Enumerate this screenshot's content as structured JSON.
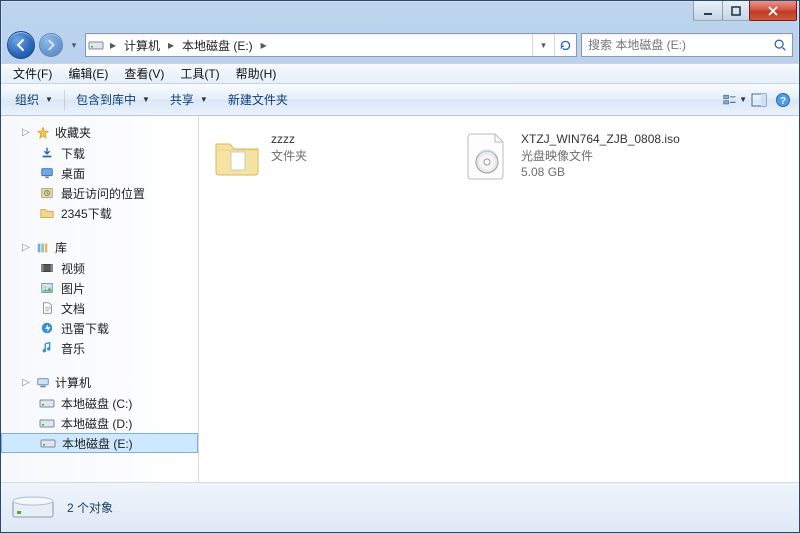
{
  "window": {
    "title": ""
  },
  "nav": {
    "crumbs": [
      "计算机",
      "本地磁盘 (E:)"
    ],
    "search_placeholder": "搜索 本地磁盘 (E:)"
  },
  "menu": {
    "file": "文件(F)",
    "edit": "编辑(E)",
    "view": "查看(V)",
    "tools": "工具(T)",
    "help": "帮助(H)"
  },
  "toolbar": {
    "organize": "组织",
    "include": "包含到库中",
    "share": "共享",
    "newfolder": "新建文件夹"
  },
  "sidebar": {
    "favorites": {
      "label": "收藏夹",
      "items": [
        {
          "label": "下载",
          "icon": "download-icon"
        },
        {
          "label": "桌面",
          "icon": "desktop-icon"
        },
        {
          "label": "最近访问的位置",
          "icon": "recent-icon"
        },
        {
          "label": "2345下载",
          "icon": "folder-icon"
        }
      ]
    },
    "libraries": {
      "label": "库",
      "items": [
        {
          "label": "视频",
          "icon": "video-icon"
        },
        {
          "label": "图片",
          "icon": "pictures-icon"
        },
        {
          "label": "文档",
          "icon": "documents-icon"
        },
        {
          "label": "迅雷下载",
          "icon": "thunder-icon"
        },
        {
          "label": "音乐",
          "icon": "music-icon"
        }
      ]
    },
    "computer": {
      "label": "计算机",
      "items": [
        {
          "label": "本地磁盘 (C:)",
          "icon": "drive-icon",
          "selected": false
        },
        {
          "label": "本地磁盘 (D:)",
          "icon": "drive-icon",
          "selected": false
        },
        {
          "label": "本地磁盘 (E:)",
          "icon": "drive-icon",
          "selected": true
        }
      ]
    }
  },
  "items": [
    {
      "name": "zzzz",
      "type": "文件夹",
      "size": "",
      "kind": "folder"
    },
    {
      "name": "XTZJ_WIN764_ZJB_0808.iso",
      "type": "光盘映像文件",
      "size": "5.08 GB",
      "kind": "iso"
    }
  ],
  "status": {
    "text": "2 个对象"
  }
}
